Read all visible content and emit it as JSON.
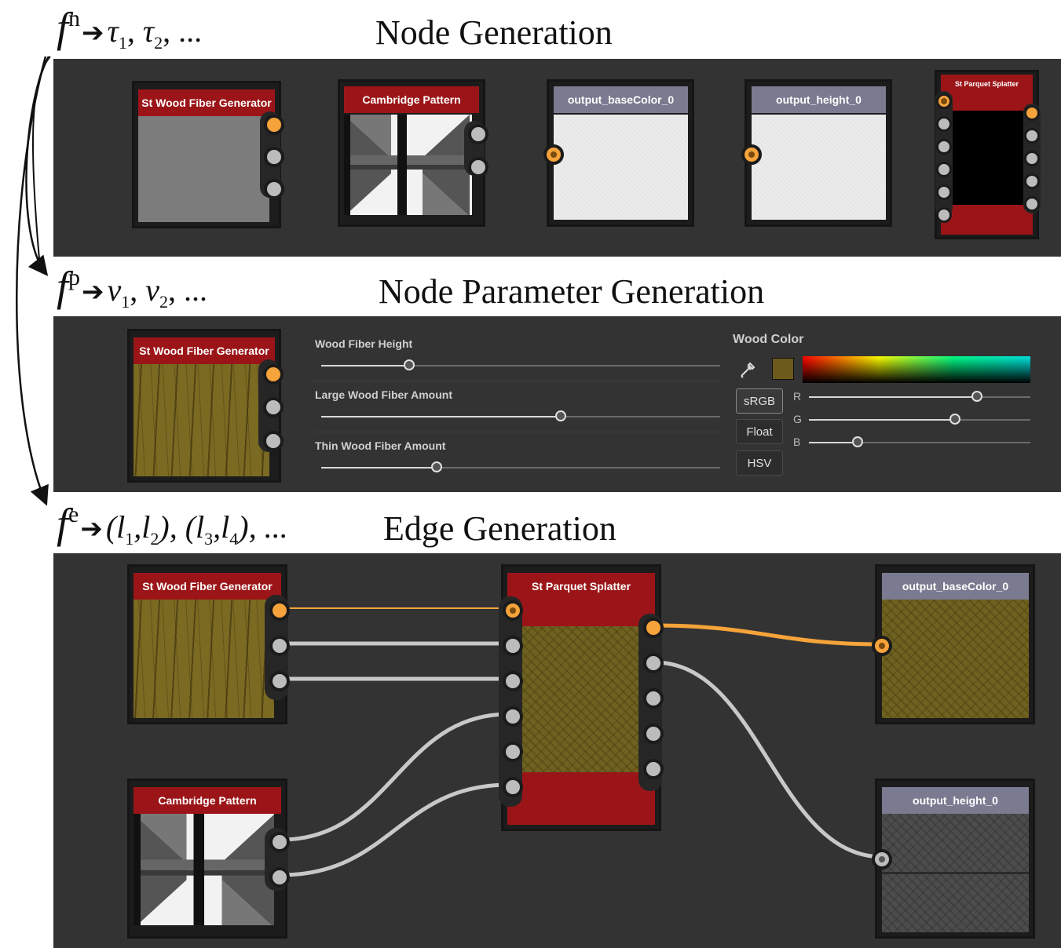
{
  "sections": {
    "node": {
      "heading": "Node Generation",
      "func": "f",
      "sup": "n",
      "arrow": "➔",
      "items": [
        {
          "sym": "τ",
          "sub": "1",
          "sep": ", "
        },
        {
          "sym": "τ",
          "sub": "2",
          "sep": ", ..."
        }
      ]
    },
    "param": {
      "heading": "Node Parameter Generation",
      "func": "f",
      "sup": "p",
      "arrow": "➔",
      "items": [
        {
          "sym": "v",
          "sub": "1",
          "sep": ", "
        },
        {
          "sym": "v",
          "sub": "2",
          "sep": ", ..."
        }
      ]
    },
    "edge": {
      "heading": "Edge Generation",
      "func": "f",
      "sup": "e",
      "arrow": "➔",
      "text_a": "(l",
      "s1": "1",
      "c1": ",l",
      "s2": "2",
      "text_b": "), (l",
      "s3": "3",
      "c2": ",l",
      "s4": "4",
      "text_c": "), ..."
    }
  },
  "panel1": {
    "nodes": [
      {
        "title": "St Wood Fiber Generator"
      },
      {
        "title": "Cambridge Pattern"
      },
      {
        "title": "output_baseColor_0"
      },
      {
        "title": "output_height_0"
      },
      {
        "title": "St Parquet Splatter"
      }
    ]
  },
  "panel2": {
    "node_title": "St Wood Fiber Generator",
    "params": [
      {
        "label": "Wood Fiber Height",
        "value": 0.22
      },
      {
        "label": "Large Wood Fiber Amount",
        "value": 0.6
      },
      {
        "label": "Thin Wood Fiber Amount",
        "value": 0.29
      }
    ],
    "color_label": "Wood Color",
    "swatch": "#6b5a1c",
    "buttons": [
      "sRGB",
      "Float",
      "HSV"
    ],
    "channels": [
      {
        "label": "R",
        "value": 0.76
      },
      {
        "label": "G",
        "value": 0.66
      },
      {
        "label": "B",
        "value": 0.22
      }
    ]
  },
  "panel3": {
    "nodes": {
      "wood": "St Wood Fiber Generator",
      "cambridge": "Cambridge Pattern",
      "splatter": "St Parquet Splatter",
      "basecolor": "output_baseColor_0",
      "height": "output_height_0"
    }
  },
  "colors": {
    "panel": "#333333",
    "title_red": "#9b1518",
    "title_gray": "#7a7a90",
    "port_orange": "#f5a33a",
    "port_gray": "#bcbcbc",
    "edge_gray": "#c8c8c8"
  }
}
